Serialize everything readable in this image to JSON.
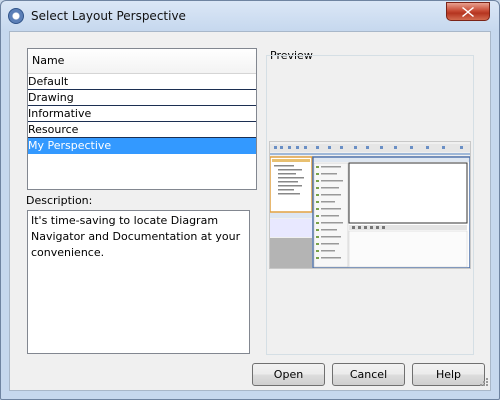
{
  "window": {
    "title": "Select Layout Perspective"
  },
  "list": {
    "header": "Name",
    "items": [
      "Default",
      "Drawing",
      "Informative",
      "Resource",
      "My Perspective"
    ],
    "selected": "My Perspective"
  },
  "description": {
    "label": "Description:",
    "text": "It's time-saving to locate Diagram Navigator and Documentation at your convenience."
  },
  "preview": {
    "label": "Preview"
  },
  "buttons": {
    "open": "Open",
    "cancel": "Cancel",
    "help": "Help"
  },
  "colors": {
    "selection": "#3399ff",
    "close_button": "#c84c36",
    "frame": "#c6d8ee"
  }
}
